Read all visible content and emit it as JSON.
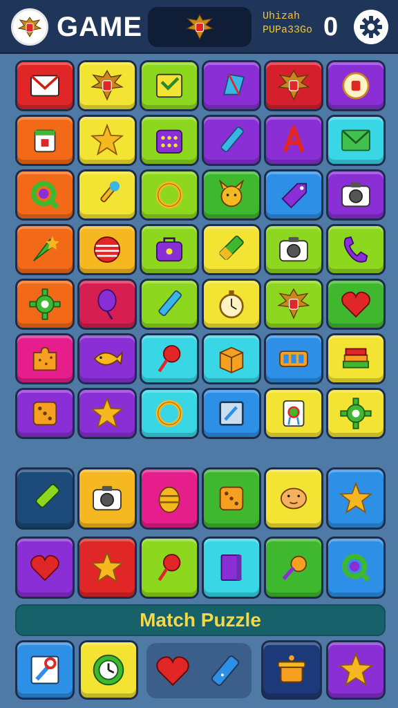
{
  "header": {
    "title": "GAME",
    "score_label_line1": "Uhizah",
    "score_label_line2": "PUPa33Go",
    "score_value": "0",
    "avatar_icon": "garuda-emblem-icon",
    "center_icon": "garuda-emblem-icon",
    "settings_icon": "gear-icon"
  },
  "colors": {
    "background": "#4f7aa6",
    "topbar": "#1f3559",
    "banner": "#17626a",
    "banner_text": "#f4d84a"
  },
  "board": {
    "rows": [
      [
        {
          "icon": "envelope-icon",
          "color": "#e02626"
        },
        {
          "icon": "garuda-emblem-icon",
          "color": "#f3e332"
        },
        {
          "icon": "inbox-check-icon",
          "color": "#8dd81f"
        },
        {
          "icon": "kite-icon",
          "color": "#8a2fd6"
        },
        {
          "icon": "garuda-emblem-icon",
          "color": "#d61f2c"
        },
        {
          "icon": "garuda-badge-icon",
          "color": "#8a2fd6"
        }
      ],
      [
        {
          "icon": "jar-icon",
          "color": "#f26a18"
        },
        {
          "icon": "star-icon",
          "color": "#f3e332"
        },
        {
          "icon": "calculator-bag-icon",
          "color": "#8dd81f"
        },
        {
          "icon": "pencil-icon",
          "color": "#8a2fd6"
        },
        {
          "icon": "letter-a-icon",
          "color": "#8a2fd6"
        },
        {
          "icon": "mail-icon",
          "color": "#39d6e6"
        }
      ],
      [
        {
          "icon": "search-ring-icon",
          "color": "#f26a18"
        },
        {
          "icon": "paintbrush-icon",
          "color": "#f3e332"
        },
        {
          "icon": "ring-icon",
          "color": "#8dd81f"
        },
        {
          "icon": "animal-face-icon",
          "color": "#3fb82f"
        },
        {
          "icon": "tag-icon",
          "color": "#2e8fe6"
        },
        {
          "icon": "camera-icon",
          "color": "#8a2fd6"
        }
      ],
      [
        {
          "icon": "rocket-icon",
          "color": "#f26a18"
        },
        {
          "icon": "ball-icon",
          "color": "#f5b820"
        },
        {
          "icon": "bag-icon",
          "color": "#8dd81f"
        },
        {
          "icon": "crayon-icon",
          "color": "#f3e332"
        },
        {
          "icon": "camera-icon",
          "color": "#8dd81f"
        },
        {
          "icon": "phone-icon",
          "color": "#8dd81f"
        }
      ],
      [
        {
          "icon": "gear-icon",
          "color": "#f26a18"
        },
        {
          "icon": "balloon-icon",
          "color": "#d61f50"
        },
        {
          "icon": "pencil-icon",
          "color": "#8dd81f"
        },
        {
          "icon": "stopwatch-icon",
          "color": "#f3e332"
        },
        {
          "icon": "garuda-emblem-icon",
          "color": "#8dd81f"
        },
        {
          "icon": "heart-icon",
          "color": "#3fb82f"
        }
      ],
      [
        {
          "icon": "puzzle-piece-icon",
          "color": "#e61e8c"
        },
        {
          "icon": "fish-icon",
          "color": "#8a2fd6"
        },
        {
          "icon": "lollipop-icon",
          "color": "#39d6e6"
        },
        {
          "icon": "box-icon",
          "color": "#39d6e6"
        },
        {
          "icon": "battery-icon",
          "color": "#2e8fe6"
        },
        {
          "icon": "books-icon",
          "color": "#f3e332"
        }
      ],
      [
        {
          "icon": "dice-icon",
          "color": "#8a2fd6"
        },
        {
          "icon": "star-icon",
          "color": "#8a2fd6"
        },
        {
          "icon": "ring-icon",
          "color": "#39d6e6"
        },
        {
          "icon": "frame-icon",
          "color": "#2e8fe6"
        },
        {
          "icon": "badge-icon",
          "color": "#f3e332"
        },
        {
          "icon": "gear-icon",
          "color": "#f3e332"
        }
      ]
    ]
  },
  "lower_board": {
    "rows": [
      [
        {
          "icon": "marker-icon",
          "color": "#1c4a7a"
        },
        {
          "icon": "camera-icon",
          "color": "#f5b820"
        },
        {
          "icon": "easter-egg-icon",
          "color": "#e61e8c"
        },
        {
          "icon": "dice-icon",
          "color": "#3fb82f"
        },
        {
          "icon": "dog-face-icon",
          "color": "#f3e332"
        },
        {
          "icon": "star-icon",
          "color": "#2e8fe6"
        }
      ],
      [
        {
          "icon": "heart-icon",
          "color": "#8a2fd6"
        },
        {
          "icon": "star-icon",
          "color": "#e02626"
        },
        {
          "icon": "lollipop-icon",
          "color": "#8dd81f"
        },
        {
          "icon": "book-icon",
          "color": "#39d6e6"
        },
        {
          "icon": "ice-cream-icon",
          "color": "#3fb82f"
        },
        {
          "icon": "search-ring-icon",
          "color": "#2e8fe6"
        }
      ]
    ]
  },
  "banner": {
    "text": "Match Puzzle"
  },
  "bottom_bar": {
    "left1": {
      "icon": "wrench-icon",
      "color": "#2e8fe6"
    },
    "left2": {
      "icon": "timer-gear-icon",
      "color": "#f3e332"
    },
    "tray": [
      {
        "icon": "heart-icon"
      },
      {
        "icon": "usb-stick-icon"
      }
    ],
    "right1": {
      "icon": "pot-icon",
      "color": "#1c3a7a"
    },
    "right2": {
      "icon": "star-icon",
      "color": "#8a2fd6"
    }
  }
}
